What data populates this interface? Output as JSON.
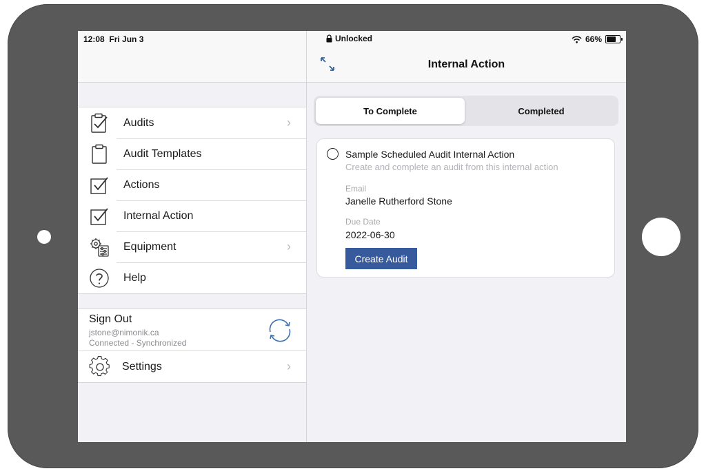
{
  "status_bar": {
    "time": "12:08",
    "date": "Fri Jun 3",
    "lock_text": "Unlocked",
    "battery": "66%"
  },
  "sidebar": {
    "menu": [
      {
        "label": "Audits",
        "icon": "clipboard-check-icon",
        "has_chevron": true
      },
      {
        "label": "Audit Templates",
        "icon": "clipboard-icon",
        "has_chevron": false
      },
      {
        "label": "Actions",
        "icon": "checkbox-check-icon",
        "has_chevron": false
      },
      {
        "label": "Internal Action",
        "icon": "checkbox-check-icon",
        "has_chevron": false
      },
      {
        "label": "Equipment",
        "icon": "equipment-gear-icon",
        "has_chevron": true
      },
      {
        "label": "Help",
        "icon": "help-circle-icon",
        "has_chevron": false
      }
    ],
    "account": {
      "title": "Sign Out",
      "email": "jstone@nimonik.ca",
      "status": "Connected - Synchronized",
      "sync_icon": "sync-icon"
    },
    "settings": {
      "label": "Settings",
      "icon": "settings-gear-icon"
    }
  },
  "detail": {
    "title": "Internal Action",
    "segments": {
      "to_complete": "To Complete",
      "completed": "Completed",
      "selected": "To Complete"
    },
    "card": {
      "title": "Sample Scheduled Audit Internal Action",
      "subtitle": "Create and complete an audit from this internal action",
      "email_label": "Email",
      "email_value": "Janelle Rutherford Stone",
      "due_label": "Due Date",
      "due_value": "2022-06-30",
      "button": "Create Audit"
    }
  },
  "colors": {
    "accent": "#365a9c",
    "sync_icon": "#3a6fb0",
    "bezel": "#595959",
    "background": "#f2f2f6"
  }
}
